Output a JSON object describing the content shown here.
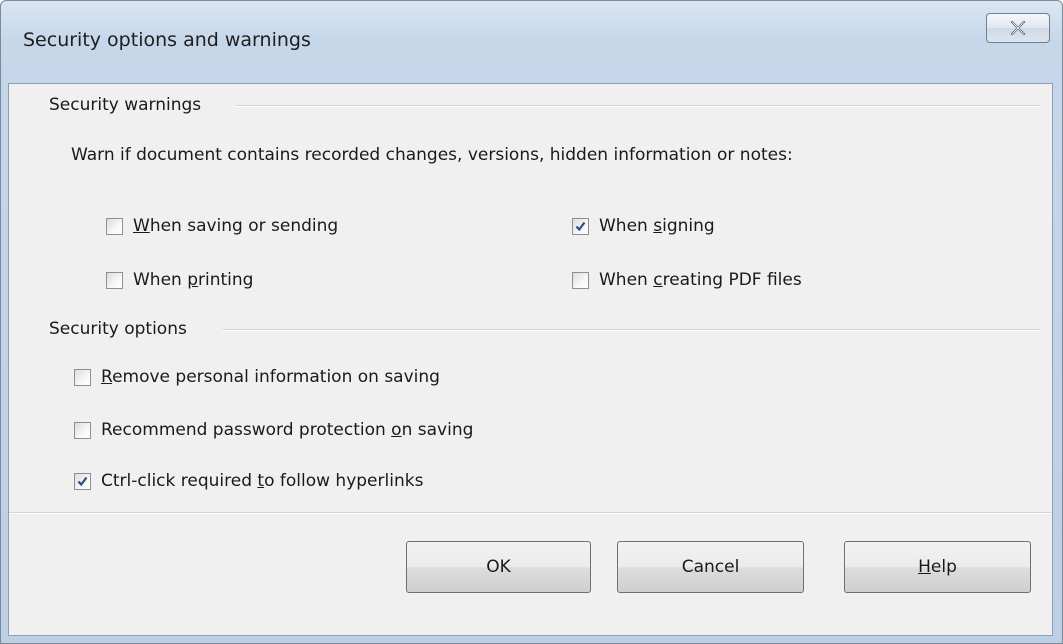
{
  "window": {
    "title": "Security options and warnings",
    "close_icon": "close-x-icon"
  },
  "security_warnings": {
    "title": "Security warnings",
    "description": "Warn if document contains recorded changes, versions, hidden information or notes:",
    "options": [
      {
        "pre": "",
        "key": "W",
        "post": "hen saving or sending",
        "checked": false
      },
      {
        "pre": "When ",
        "key": "s",
        "post": "igning",
        "checked": true
      },
      {
        "pre": "When ",
        "key": "p",
        "post": "rinting",
        "checked": false
      },
      {
        "pre": "When ",
        "key": "c",
        "post": "reating PDF files",
        "checked": false
      }
    ]
  },
  "security_options": {
    "title": "Security options",
    "options": [
      {
        "pre": "",
        "key": "R",
        "post": "emove personal information on saving",
        "checked": false
      },
      {
        "pre": "Recommend password protection ",
        "key": "o",
        "post": "n saving",
        "checked": false
      },
      {
        "pre": "Ctrl-click required ",
        "key": "t",
        "post": "o follow hyperlinks",
        "checked": true
      }
    ]
  },
  "buttons": {
    "ok": "OK",
    "cancel": "Cancel",
    "help_key": "H",
    "help_rest": "elp"
  },
  "colors": {
    "title_gradient_top": "#d9e6f3",
    "client_background": "#f0f0f0",
    "check_color": "#2a4f8c"
  }
}
